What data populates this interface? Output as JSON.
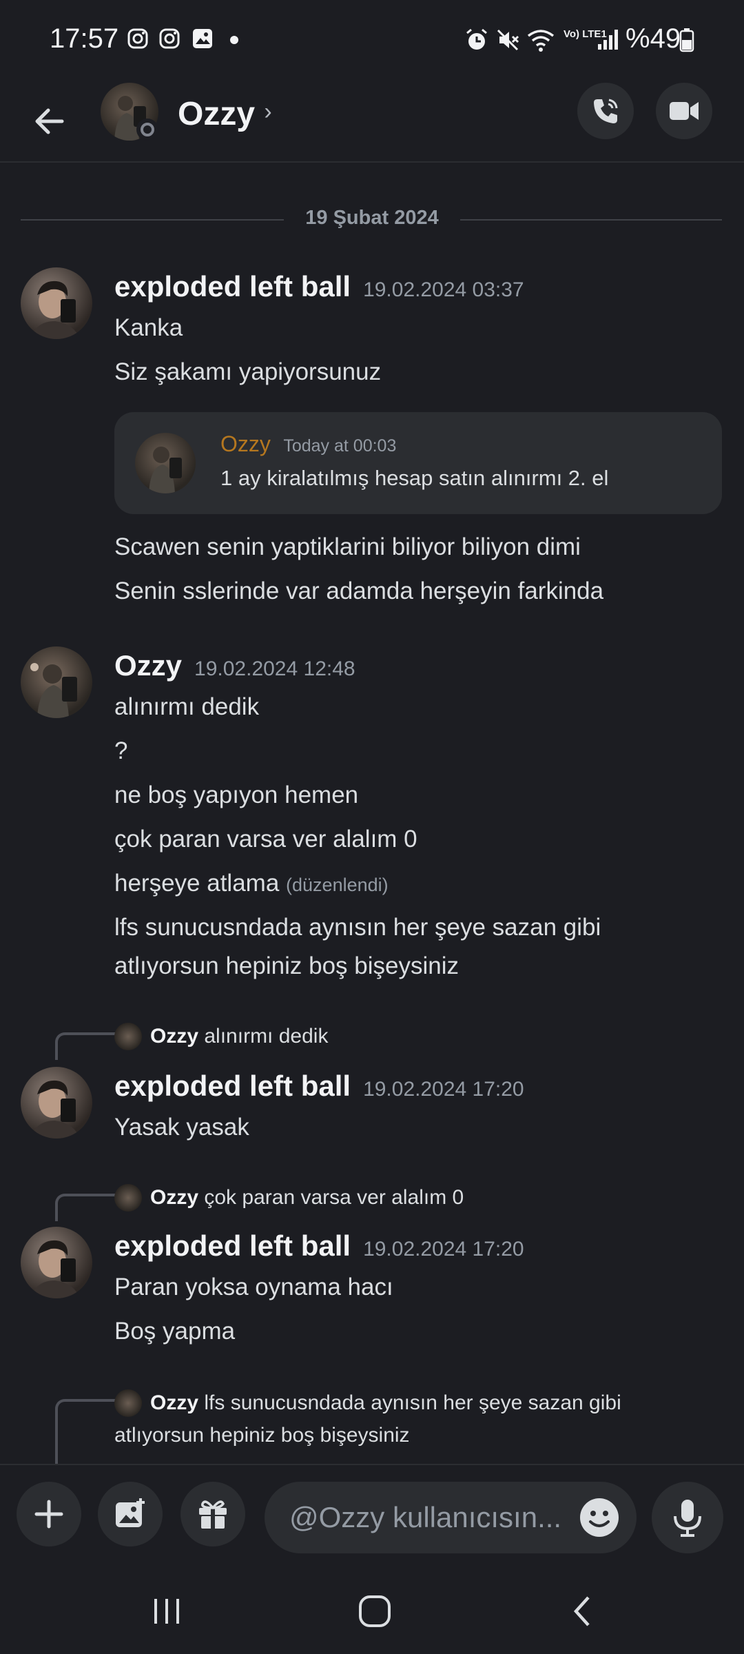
{
  "status_bar": {
    "time": "17:57",
    "battery": "%49",
    "network": "Vo) LTE1"
  },
  "header": {
    "contact_name": "Ozzy",
    "chevron": "›"
  },
  "date_divider": "19 Şubat 2024",
  "messages": [
    {
      "author": "exploded left ball",
      "timestamp": "19.02.2024 03:37",
      "lines": [
        "Kanka",
        "Siz şakamı yapiyorsunuz"
      ],
      "embed": {
        "author": "Ozzy",
        "timestamp": "Today at 00:03",
        "text": "1 ay kiralatılmış hesap satın alınırmı 2. el"
      },
      "after_lines": [
        "Scawen senin yaptiklarini biliyor biliyon dimi",
        "Senin sslerinde var adamda herşeyin farkinda"
      ]
    },
    {
      "author": "Ozzy",
      "timestamp": "19.02.2024 12:48",
      "lines": [
        "alınırmı dedik",
        "?",
        "ne boş yapıyon hemen",
        "çok paran varsa ver alalım 0",
        "herşeye atlama",
        "lfs sunucusndada aynısın her şeye sazan gibi",
        "atlıyorsun hepiniz boş bişeysiniz"
      ],
      "edited": "(düzenlendi)"
    },
    {
      "reply_to": {
        "author": "Ozzy",
        "text": "alınırmı dedik"
      },
      "author": "exploded left ball",
      "timestamp": "19.02.2024 17:20",
      "lines": [
        "Yasak yasak"
      ]
    },
    {
      "reply_to": {
        "author": "Ozzy",
        "text": "çok paran varsa ver alalım 0"
      },
      "author": "exploded left ball",
      "timestamp": "19.02.2024 17:20",
      "lines": [
        "Paran yoksa oynama hacı",
        "Boş yapma"
      ]
    },
    {
      "reply_to": {
        "author": "Ozzy",
        "text": "lfs sunucusndada aynısın her şeye sazan gibi",
        "text_cont": "atlıyorsun hepiniz boş bişeysiniz"
      }
    }
  ],
  "composer": {
    "placeholder": "@Ozzy kullanıcısın..."
  },
  "icons": {
    "back": "arrow-left-icon",
    "call": "phone-icon",
    "video": "video-camera-icon",
    "add": "plus-icon",
    "gallery": "image-icon",
    "gift": "gift-icon",
    "emoji": "emoji-icon",
    "mic": "microphone-icon"
  },
  "colors": {
    "background": "#1c1d22",
    "embed_background": "#2b2d31",
    "embed_author": "#b5771f",
    "text": "#dbdee1",
    "muted": "#949ba4"
  }
}
